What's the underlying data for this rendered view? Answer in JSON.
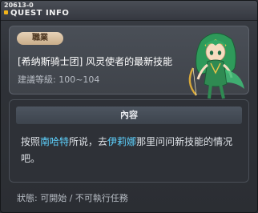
{
  "window": {
    "quest_id": "20613-0",
    "title": "QUEST INFO"
  },
  "quest": {
    "job_label": "職業",
    "name": "[希纳斯骑士团] 风灵使者的最新技能",
    "level_label": "建議等級",
    "level_separator": ": ",
    "level_range": "100~104"
  },
  "npc": {
    "icon": "wind-archer-character-icon",
    "hair_color": "#2e9a5a",
    "outfit_color": "#2f8a52"
  },
  "content": {
    "header": "內容",
    "text_part1": "按照",
    "npc1": "南哈特",
    "text_part2": "所说，去",
    "npc2": "伊莉娜",
    "text_part3": "那里问问新技能的情况吧。",
    "highlight_color": "#5ed2ff"
  },
  "status": {
    "label": "狀態",
    "separator": ": ",
    "value": "可開始 / 不可執行任務"
  }
}
